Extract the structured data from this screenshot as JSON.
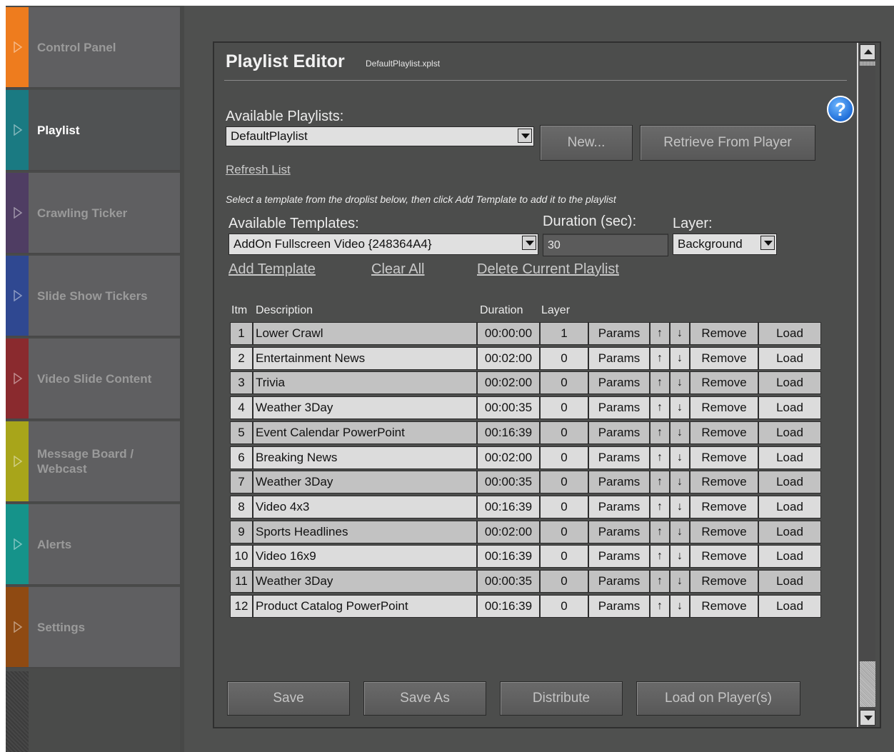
{
  "sidebar": {
    "items": [
      {
        "label": "Control Panel",
        "color": "#ee7c1e"
      },
      {
        "label": "Playlist",
        "color": "#1a7a82"
      },
      {
        "label": "Crawling Ticker",
        "color": "#4f3d63"
      },
      {
        "label": "Slide Show Tickers",
        "color": "#2f4891"
      },
      {
        "label": "Video Slide Content",
        "color": "#8a2a2e"
      },
      {
        "label": "Message Board /\nWebcast",
        "color": "#a8a51a"
      },
      {
        "label": "Alerts",
        "color": "#15938a"
      },
      {
        "label": "Settings",
        "color": "#8f4a12"
      }
    ],
    "active_index": 1
  },
  "editor": {
    "title": "Playlist Editor",
    "filename": "DefaultPlaylist.xplst",
    "available_playlists_label": "Available Playlists:",
    "selected_playlist": "DefaultPlaylist",
    "new_button": "New...",
    "retrieve_button": "Retrieve From Player",
    "refresh_link": "Refresh List",
    "hint": "Select a template from the droplist below, then click Add Template to add it to the playlist",
    "available_templates_label": "Available Templates:",
    "selected_template": "AddOn Fullscreen Video {248364A4}",
    "duration_label": "Duration (sec):",
    "duration_value": "30",
    "layer_label": "Layer:",
    "selected_layer": "Background",
    "add_template_link": "Add Template",
    "clear_all_link": "Clear All",
    "delete_playlist_link": "Delete Current Playlist"
  },
  "table": {
    "headers": {
      "item": "Itm",
      "description": "Description",
      "duration": "Duration",
      "layer": "Layer"
    },
    "params_label": "Params",
    "up_label": "↑",
    "down_label": "↓",
    "remove_label": "Remove",
    "load_label": "Load",
    "rows": [
      {
        "num": "1",
        "description": "Lower Crawl",
        "duration": "00:00:00",
        "layer": "1"
      },
      {
        "num": "2",
        "description": "Entertainment News",
        "duration": "00:02:00",
        "layer": "0"
      },
      {
        "num": "3",
        "description": "Trivia",
        "duration": "00:02:00",
        "layer": "0"
      },
      {
        "num": "4",
        "description": "Weather 3Day",
        "duration": "00:00:35",
        "layer": "0"
      },
      {
        "num": "5",
        "description": "Event Calendar PowerPoint",
        "duration": "00:16:39",
        "layer": "0"
      },
      {
        "num": "6",
        "description": "Breaking News",
        "duration": "00:02:00",
        "layer": "0"
      },
      {
        "num": "7",
        "description": "Weather 3Day",
        "duration": "00:00:35",
        "layer": "0"
      },
      {
        "num": "8",
        "description": "Video 4x3",
        "duration": "00:16:39",
        "layer": "0"
      },
      {
        "num": "9",
        "description": "Sports Headlines",
        "duration": "00:02:00",
        "layer": "0"
      },
      {
        "num": "10",
        "description": "Video 16x9",
        "duration": "00:16:39",
        "layer": "0"
      },
      {
        "num": "11",
        "description": "Weather 3Day",
        "duration": "00:00:35",
        "layer": "0"
      },
      {
        "num": "12",
        "description": "Product Catalog PowerPoint",
        "duration": "00:16:39",
        "layer": "0"
      }
    ]
  },
  "footer": {
    "save": "Save",
    "save_as": "Save As",
    "distribute": "Distribute",
    "load_on_players": "Load on Player(s)"
  },
  "icons": {
    "help": "help-icon",
    "sidebar_arrow": "play-arrow-icon"
  }
}
